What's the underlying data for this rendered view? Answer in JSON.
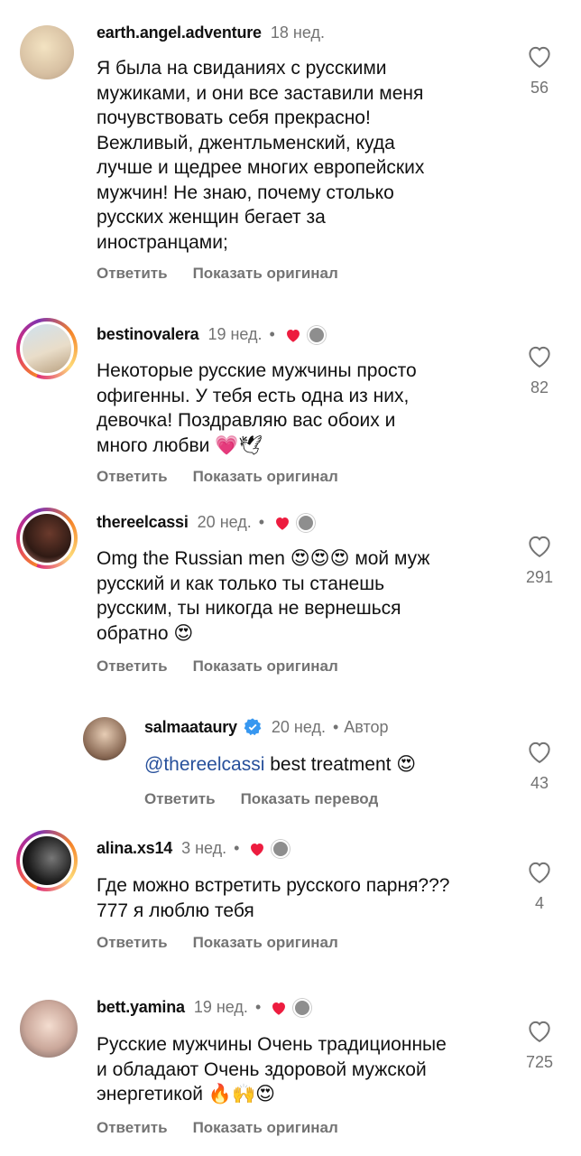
{
  "ui": {
    "reply_label": "Ответить",
    "show_original_label": "Показать оригинал",
    "show_translation_label": "Показать перевод",
    "dot": "•",
    "author_label": "Автор"
  },
  "comments": [
    {
      "username": "earth.angel.adventure",
      "time": "18 нед.",
      "lines": [
        "Я была на свиданиях с русскими",
        "мужиками, и они все заставили меня",
        "почувствовать себя прекрасно!",
        "Вежливый, джентльменский, куда",
        "лучше и щедрее многих европейских",
        "мужчин! Не знаю, почему столько",
        "русских женщин бегает за",
        "иностранцами;"
      ],
      "likes": "56"
    },
    {
      "username": "bestinovalera",
      "time": "19 нед.",
      "lines": [
        "Некоторые русские мужчины просто",
        "офигенны. У тебя есть одна из них,",
        "девочка! Поздравляю вас обоих и",
        "много любви"
      ],
      "trail_emoji": "💗🕊",
      "likes": "82"
    },
    {
      "username": "thereelcassi",
      "time": "20 нед.",
      "lines": [
        "Omg the Russian men",
        "русский и как только ты станешь",
        "русским, ты никогда не вернешься",
        "обратно"
      ],
      "line1_emoji": "😍😍😍",
      "line1_tail": "мой муж",
      "line4_emoji": "😍",
      "likes": "291"
    },
    {
      "username": "salmaataury",
      "time": "20 нед.",
      "mention": "@thereelcassi",
      "text": "best treatment",
      "trail_emoji": "😍",
      "likes": "43"
    },
    {
      "username": "alina.xs14",
      "time": "3 нед.",
      "lines": [
        "Где можно встретить русского парня???",
        "777 я люблю тебя"
      ],
      "likes": "4"
    },
    {
      "username": "bett.yamina",
      "time": "19 нед.",
      "lines": [
        "Русские мужчины Очень традиционные",
        "и обладают Очень здоровой мужской",
        "энергетикой"
      ],
      "trail_emoji": "🔥🙌😍",
      "likes": "725"
    }
  ],
  "colors": {
    "text": "#111111",
    "muted": "#737373",
    "mention": "#27509b",
    "liked_heart": "#ed1c3f",
    "verified": "#3797f0"
  },
  "icons": [
    "heart-outline-icon",
    "heart-filled-icon",
    "verified-badge-icon"
  ]
}
